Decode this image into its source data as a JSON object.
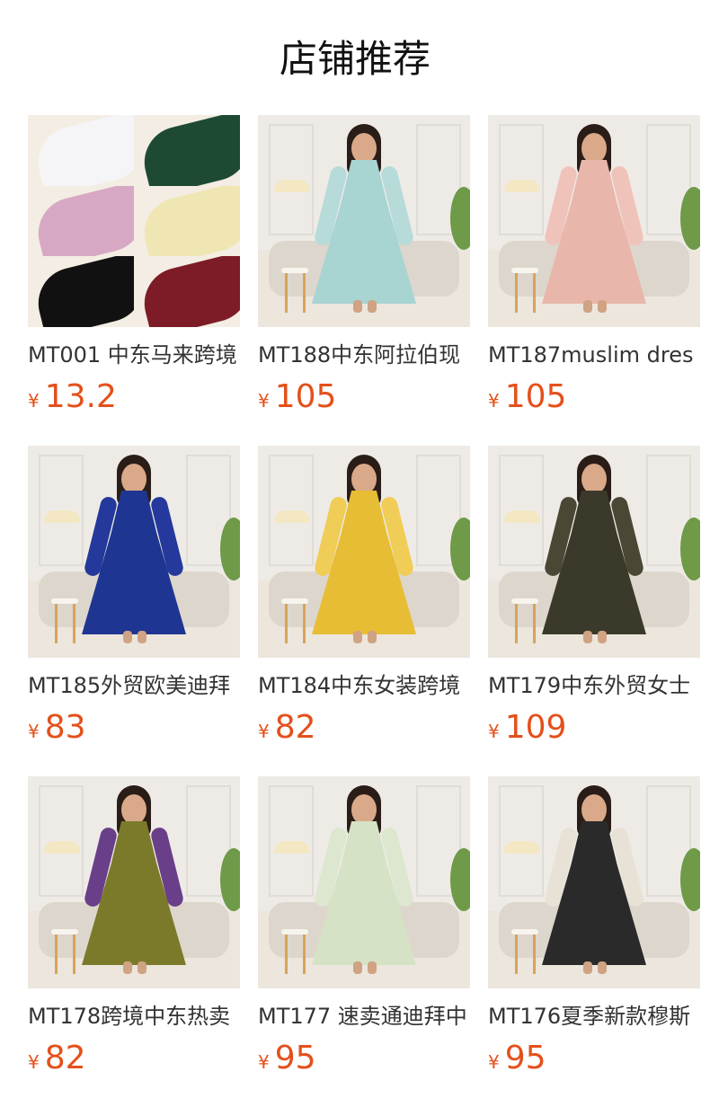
{
  "header": {
    "title": "店铺推荐"
  },
  "currency": "¥",
  "products": [
    {
      "name": "MT001 中东马来跨境",
      "price": "13.2",
      "image": "scarf-collage",
      "swatches": [
        "#f5f5f7",
        "#1e4a34",
        "#d7a8c4",
        "#efe6b3",
        "#111111",
        "#7d1c26"
      ]
    },
    {
      "name": "MT188中东阿拉伯现",
      "price": "105",
      "image": "dress",
      "dress_color": "#a8d4d2",
      "sleeve_color": "#b6dbd9"
    },
    {
      "name": "MT187muslim dres",
      "price": "105",
      "image": "dress",
      "dress_color": "#e9b6ab",
      "sleeve_color": "#efc3b9"
    },
    {
      "name": "MT185外贸欧美迪拜",
      "price": "83",
      "image": "dress",
      "dress_color": "#1f3592",
      "sleeve_color": "#24399b"
    },
    {
      "name": "MT184中东女装跨境",
      "price": "82",
      "image": "dress",
      "dress_color": "#e7bd36",
      "sleeve_color": "#f0cd56"
    },
    {
      "name": "MT179中东外贸女士",
      "price": "109",
      "image": "dress",
      "dress_color": "#3b3a2a",
      "sleeve_color": "#4a4834"
    },
    {
      "name": "MT178跨境中东热卖",
      "price": "82",
      "image": "dress",
      "dress_color": "#7b7a2b",
      "sleeve_color": "#6a3f8a"
    },
    {
      "name": "MT177 速卖通迪拜中",
      "price": "95",
      "image": "dress",
      "dress_color": "#d6e2c6",
      "sleeve_color": "#dde7cf"
    },
    {
      "name": "MT176夏季新款穆斯",
      "price": "95",
      "image": "dress",
      "dress_color": "#2a2a2a",
      "sleeve_color": "#e8e2d6"
    }
  ]
}
